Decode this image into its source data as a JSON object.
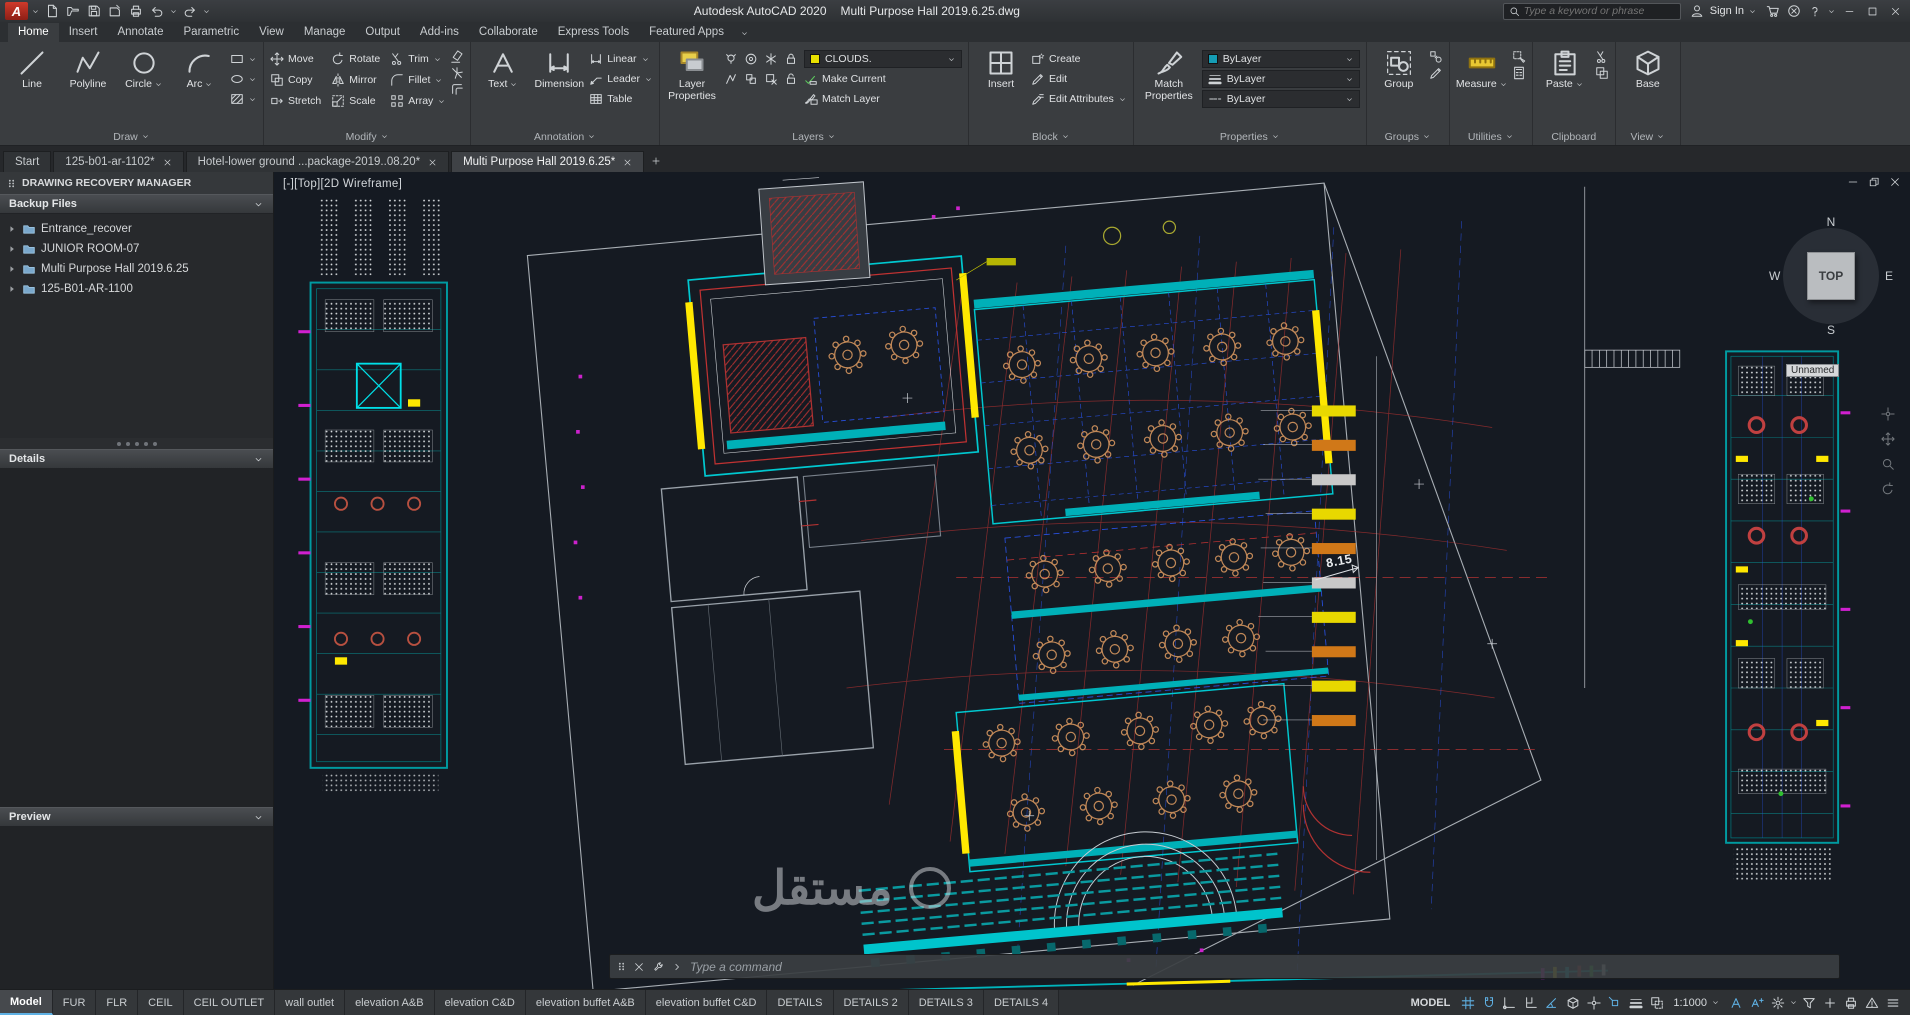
{
  "titlebar": {
    "app_title": "Autodesk AutoCAD 2020",
    "doc_title": "Multi Purpose Hall 2019.6.25.dwg",
    "search_placeholder": "Type a keyword or phrase",
    "sign_in_label": "Sign In"
  },
  "ribbon_tabs": {
    "active": "Home",
    "items": [
      "Home",
      "Insert",
      "Annotate",
      "Parametric",
      "View",
      "Manage",
      "Output",
      "Add-ins",
      "Collaborate",
      "Express Tools",
      "Featured Apps"
    ]
  },
  "ribbon": {
    "draw": {
      "title": "Draw",
      "line": "Line",
      "polyline": "Polyline",
      "circle": "Circle",
      "arc": "Arc"
    },
    "modify": {
      "title": "Modify",
      "move": "Move",
      "rotate": "Rotate",
      "trim": "Trim",
      "copy": "Copy",
      "mirror": "Mirror",
      "fillet": "Fillet",
      "stretch": "Stretch",
      "scale": "Scale",
      "array": "Array"
    },
    "annotation": {
      "title": "Annotation",
      "text": "Text",
      "dimension": "Dimension",
      "linear": "Linear",
      "leader": "Leader",
      "table": "Table"
    },
    "layers": {
      "title": "Layers",
      "layer_properties": "Layer Properties",
      "current_layer": "CLOUDS.",
      "layer_swatch": "#e8e000",
      "make_current": "Make Current",
      "match_layer": "Match Layer"
    },
    "block": {
      "title": "Block",
      "insert": "Insert",
      "create": "Create",
      "edit": "Edit",
      "edit_attributes": "Edit Attributes"
    },
    "properties": {
      "title": "Properties",
      "match_properties": "Match Properties",
      "color": "ByLayer",
      "lineweight": "ByLayer",
      "linetype": "ByLayer",
      "color_swatch": "#159cb4"
    },
    "groups": {
      "title": "Groups",
      "group": "Group"
    },
    "utilities": {
      "title": "Utilities",
      "measure": "Measure"
    },
    "clipboard": {
      "title": "Clipboard",
      "paste": "Paste"
    },
    "view": {
      "title": "View",
      "base": "Base"
    }
  },
  "doc_tabs": {
    "active": "Multi Purpose Hall 2019.6.25*",
    "items": [
      "Start",
      "125-b01-ar-1102*",
      "Hotel-lower ground ...package-2019..08.20*",
      "Multi Purpose Hall 2019.6.25*"
    ]
  },
  "sidebar": {
    "title": "DRAWING RECOVERY MANAGER",
    "backup_header": "Backup Files",
    "items": [
      "Entrance_recover",
      "JUNIOR ROOM-07",
      "Multi Purpose Hall 2019.6.25",
      "125-B01-AR-1100"
    ],
    "details_header": "Details",
    "preview_header": "Preview"
  },
  "canvas": {
    "viewport_label": "[-][Top][2D Wireframe]",
    "viewcube": {
      "n": "N",
      "e": "E",
      "s": "S",
      "w": "W",
      "face": "TOP"
    },
    "elevation_label": "8.15",
    "tooltip": "Unnamed",
    "watermark": "مستقل",
    "background": "#151a22",
    "palette": {
      "cyan": "#00c8d0",
      "red": "#b03232",
      "yellow": "#ffe800",
      "magenta": "#cc22cc",
      "blue": "#2850e0",
      "tan": "#c08858",
      "teal": "#0a9aa0"
    }
  },
  "command_line": {
    "placeholder": "Type a command"
  },
  "layout_tabs": {
    "active": "Model",
    "items": [
      "Model",
      "FUR",
      "FLR",
      "CEIL",
      "CEIL OUTLET",
      "wall outlet",
      "elevation A&B",
      "elevation C&D",
      "elevation buffet A&B",
      "elevation buffet C&D",
      "DETAILS",
      "DETAILS 2",
      "DETAILS 3",
      "DETAILS 4"
    ]
  },
  "status_bar": {
    "model_label": "MODEL",
    "scale": "1:1000"
  }
}
